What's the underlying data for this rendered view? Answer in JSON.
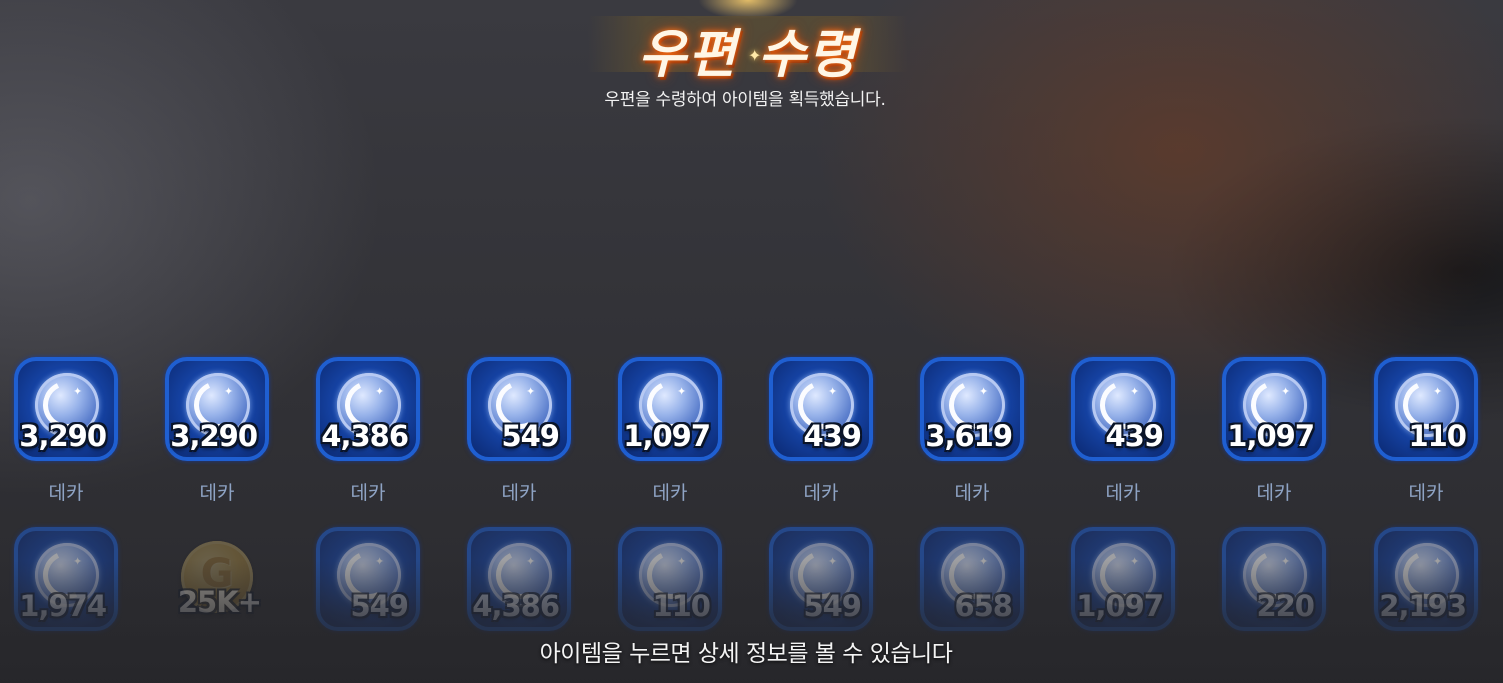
{
  "header": {
    "title": "우편 수령",
    "subtitle": "우편을 수령하여 아이템을 획득했습니다."
  },
  "footer": {
    "hint": "아이템을 누르면 상세 정보를 볼 수 있습니다"
  },
  "colors": {
    "item_frame_blue": "#1f5fd1",
    "item_name_gray_blue": "#8ea3c4",
    "title_glow_orange": "#ff7a1a",
    "gold_coin": "#e2b549"
  },
  "items": {
    "row1": [
      {
        "amount": "3,290",
        "name": "데카",
        "icon": "deka-moon-coin-icon"
      },
      {
        "amount": "3,290",
        "name": "데카",
        "icon": "deka-moon-coin-icon"
      },
      {
        "amount": "4,386",
        "name": "데카",
        "icon": "deka-moon-coin-icon"
      },
      {
        "amount": "549",
        "name": "데카",
        "icon": "deka-moon-coin-icon"
      },
      {
        "amount": "1,097",
        "name": "데카",
        "icon": "deka-moon-coin-icon"
      },
      {
        "amount": "439",
        "name": "데카",
        "icon": "deka-moon-coin-icon"
      },
      {
        "amount": "3,619",
        "name": "데카",
        "icon": "deka-moon-coin-icon"
      },
      {
        "amount": "439",
        "name": "데카",
        "icon": "deka-moon-coin-icon"
      },
      {
        "amount": "1,097",
        "name": "데카",
        "icon": "deka-moon-coin-icon"
      },
      {
        "amount": "110",
        "name": "데카",
        "icon": "deka-moon-coin-icon"
      }
    ],
    "row2": [
      {
        "amount": "1,974",
        "icon": "deka-moon-coin-icon"
      },
      {
        "amount": "25K+",
        "icon": "gold-coin-icon"
      },
      {
        "amount": "549",
        "icon": "deka-moon-coin-icon"
      },
      {
        "amount": "4,386",
        "icon": "deka-moon-coin-icon"
      },
      {
        "amount": "110",
        "icon": "deka-moon-coin-icon"
      },
      {
        "amount": "549",
        "icon": "deka-moon-coin-icon"
      },
      {
        "amount": "658",
        "icon": "deka-moon-coin-icon"
      },
      {
        "amount": "1,097",
        "icon": "deka-moon-coin-icon"
      },
      {
        "amount": "220",
        "icon": "deka-moon-coin-icon"
      },
      {
        "amount": "2,193",
        "icon": "deka-moon-coin-icon"
      }
    ]
  }
}
